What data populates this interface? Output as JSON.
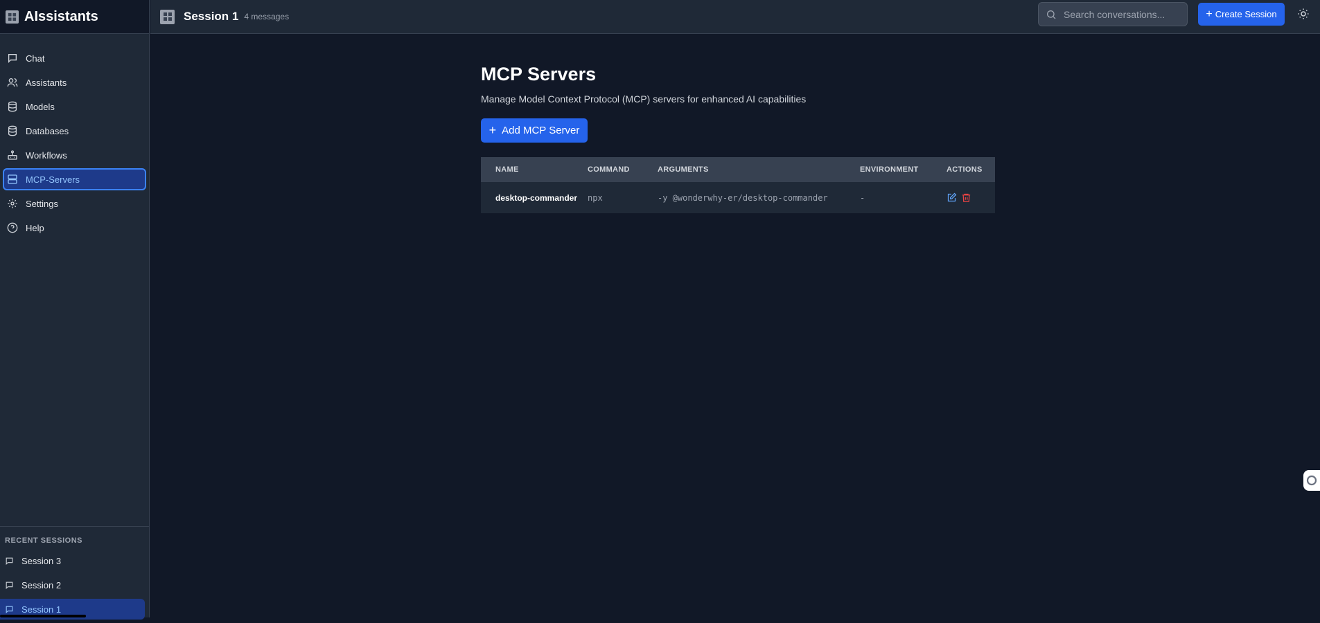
{
  "app": {
    "name": "AIssistants"
  },
  "nav": [
    {
      "key": "chat",
      "label": "Chat",
      "icon": "chat-icon"
    },
    {
      "key": "assistants",
      "label": "Assistants",
      "icon": "users-icon"
    },
    {
      "key": "models",
      "label": "Models",
      "icon": "database-icon"
    },
    {
      "key": "databases",
      "label": "Databases",
      "icon": "database-icon"
    },
    {
      "key": "workflows",
      "label": "Workflows",
      "icon": "workflow-icon"
    },
    {
      "key": "mcp-servers",
      "label": "MCP-Servers",
      "icon": "server-icon",
      "active": true
    },
    {
      "key": "settings",
      "label": "Settings",
      "icon": "gear-icon"
    },
    {
      "key": "help",
      "label": "Help",
      "icon": "help-icon"
    }
  ],
  "recent": {
    "header": "RECENT SESSIONS",
    "sessions": [
      {
        "label": "Session 3"
      },
      {
        "label": "Session 2"
      },
      {
        "label": "Session 1",
        "active": true
      }
    ]
  },
  "topbar": {
    "session_title": "Session 1",
    "message_count": "4 messages",
    "search_placeholder": "Search conversations...",
    "create_label": "Create Session"
  },
  "page": {
    "title": "MCP Servers",
    "description": "Manage Model Context Protocol (MCP) servers for enhanced AI capabilities",
    "add_label": "Add MCP Server"
  },
  "table": {
    "headers": {
      "name": "NAME",
      "command": "COMMAND",
      "arguments": "ARGUMENTS",
      "environment": "ENVIRONMENT",
      "actions": "ACTIONS"
    },
    "rows": [
      {
        "name": "desktop-commander",
        "command": "npx",
        "arguments": "-y @wonderwhy-er/desktop-commander",
        "environment": "-"
      }
    ]
  },
  "colors": {
    "accent": "#2563eb",
    "active_bg": "#1e3a8a",
    "edit_icon": "#60a5fa",
    "delete_icon": "#ef4444"
  }
}
